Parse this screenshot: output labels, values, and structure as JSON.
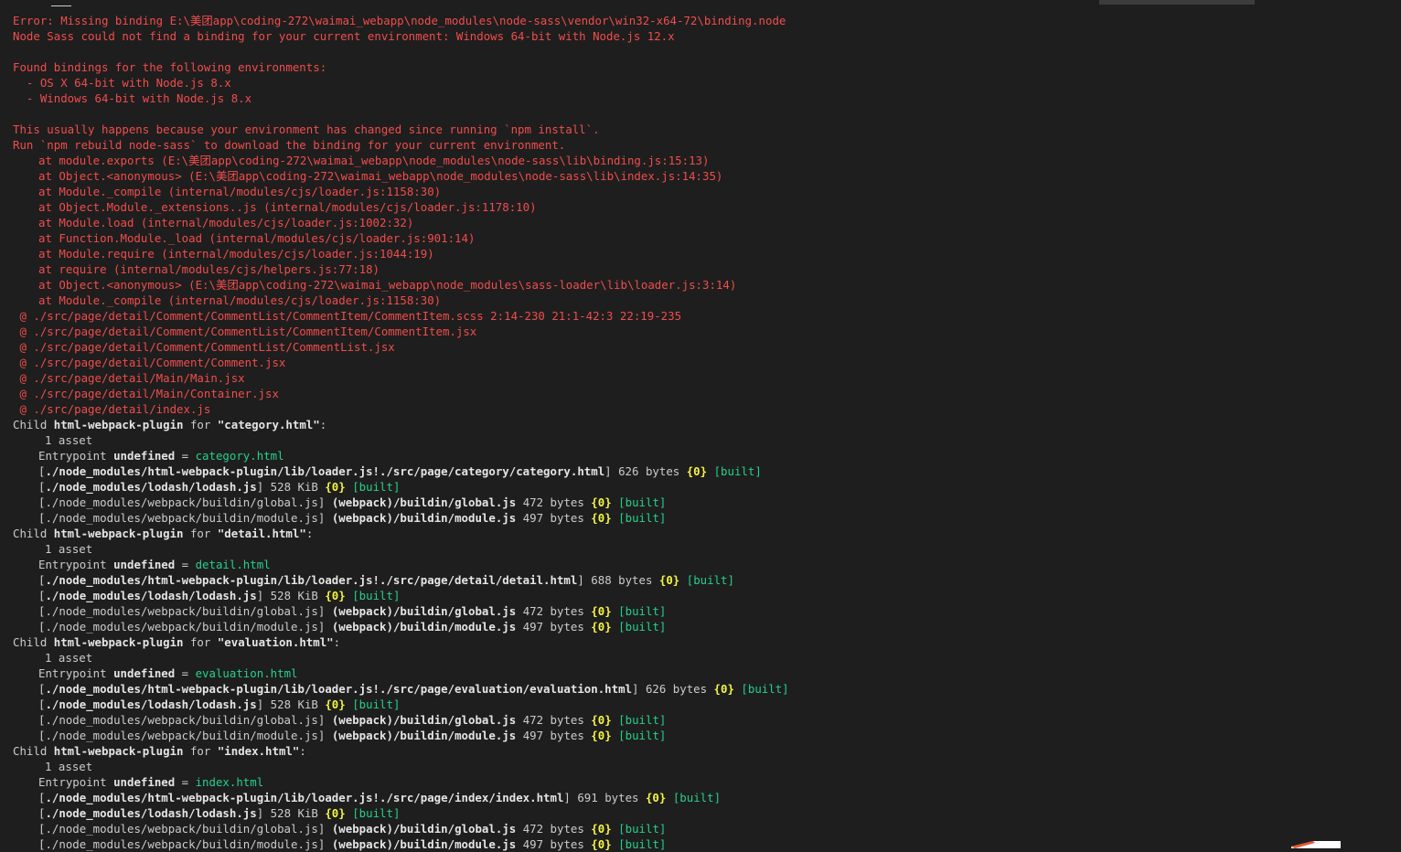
{
  "error": {
    "lines": [
      "Error: Missing binding E:\\美团app\\coding-272\\waimai_webapp\\node_modules\\node-sass\\vendor\\win32-x64-72\\binding.node",
      "Node Sass could not find a binding for your current environment: Windows 64-bit with Node.js 12.x",
      "",
      "Found bindings for the following environments:",
      "  - OS X 64-bit with Node.js 8.x",
      "  - Windows 64-bit with Node.js 8.x",
      "",
      "This usually happens because your environment has changed since running `npm install`.",
      "Run `npm rebuild node-sass` to download the binding for your current environment."
    ],
    "stack": [
      "at module.exports (E:\\美团app\\coding-272\\waimai_webapp\\node_modules\\node-sass\\lib\\binding.js:15:13)",
      "at Object.<anonymous> (E:\\美团app\\coding-272\\waimai_webapp\\node_modules\\node-sass\\lib\\index.js:14:35)",
      "at Module._compile (internal/modules/cjs/loader.js:1158:30)",
      "at Object.Module._extensions..js (internal/modules/cjs/loader.js:1178:10)",
      "at Module.load (internal/modules/cjs/loader.js:1002:32)",
      "at Function.Module._load (internal/modules/cjs/loader.js:901:14)",
      "at Module.require (internal/modules/cjs/loader.js:1044:19)",
      "at require (internal/modules/cjs/helpers.js:77:18)",
      "at Object.<anonymous> (E:\\美团app\\coding-272\\waimai_webapp\\node_modules\\sass-loader\\lib\\loader.js:3:14)",
      "at Module._compile (internal/modules/cjs/loader.js:1158:30)"
    ],
    "chain": [
      " @ ./src/page/detail/Comment/CommentList/CommentItem/CommentItem.scss 2:14-230 21:1-42:3 22:19-235",
      " @ ./src/page/detail/Comment/CommentList/CommentItem/CommentItem.jsx",
      " @ ./src/page/detail/Comment/CommentList/CommentList.jsx",
      " @ ./src/page/detail/Comment/Comment.jsx",
      " @ ./src/page/detail/Main/Main.jsx",
      " @ ./src/page/detail/Main/Container.jsx",
      " @ ./src/page/detail/index.js"
    ]
  },
  "common": {
    "child_prefix": "Child ",
    "plugin_name": "html-webpack-plugin",
    "for_word": " for ",
    "colon": ":",
    "asset": "1 asset",
    "entrypoint": "Entrypoint ",
    "undefined": "undefined",
    "equals": " = ",
    "open_bracket": "[",
    "close_bracket": "]",
    "lodash_path": "./node_modules/lodash/lodash.js",
    "lodash_size": " 528 KiB ",
    "chunk": "{0}",
    "built": "[built]",
    "global_path": "./node_modules/webpack/buildin/global.js",
    "global_alias": "(webpack)/buildin/global.js",
    "global_size": " 472 bytes ",
    "module_path": "./node_modules/webpack/buildin/module.js",
    "module_alias": "(webpack)/buildin/module.js",
    "module_size": " 497 bytes "
  },
  "children": [
    {
      "name": "\"category.html\"",
      "entry": "category.html",
      "loader_path": "./node_modules/html-webpack-plugin/lib/loader.js!./src/page/category/category.html",
      "loader_size": " 626 bytes "
    },
    {
      "name": "\"detail.html\"",
      "entry": "detail.html",
      "loader_path": "./node_modules/html-webpack-plugin/lib/loader.js!./src/page/detail/detail.html",
      "loader_size": " 688 bytes "
    },
    {
      "name": "\"evaluation.html\"",
      "entry": "evaluation.html",
      "loader_path": "./node_modules/html-webpack-plugin/lib/loader.js!./src/page/evaluation/evaluation.html",
      "loader_size": " 626 bytes "
    },
    {
      "name": "\"index.html\"",
      "entry": "index.html",
      "loader_path": "./node_modules/html-webpack-plugin/lib/loader.js!./src/page/index/index.html",
      "loader_size": " 691 bytes "
    }
  ],
  "colors": {
    "error": "#f14c4c",
    "built": "#23d18b",
    "chunk": "#f5f543",
    "background": "#1e1e1e"
  }
}
